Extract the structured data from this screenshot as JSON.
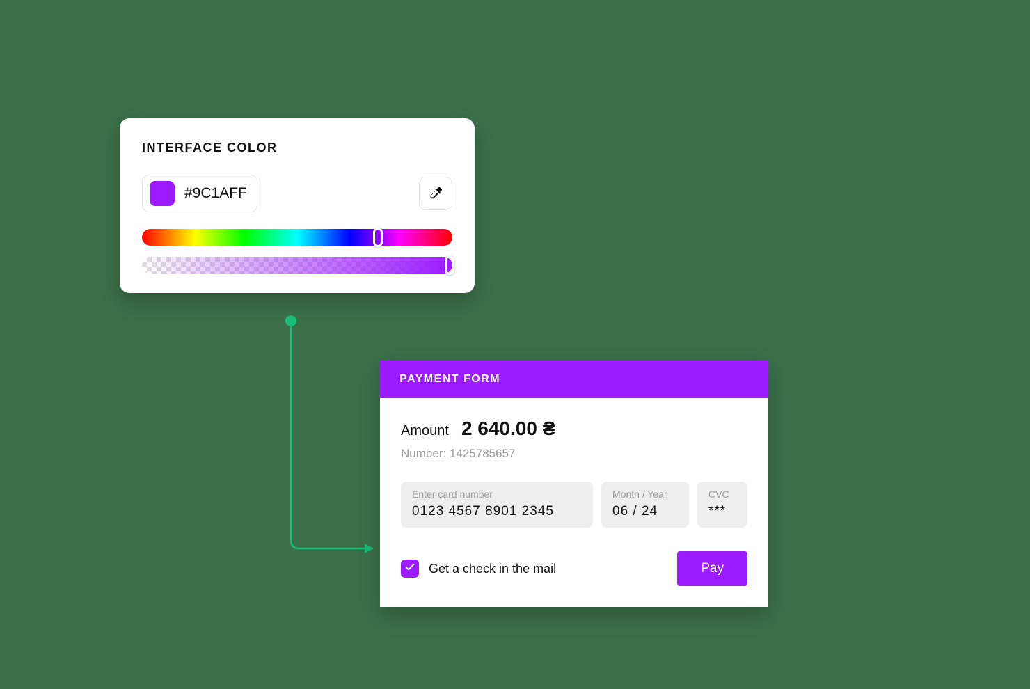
{
  "accent_color": "#9C1AFF",
  "connector_color": "#1abc7a",
  "color_picker": {
    "title": "INTERFACE COLOR",
    "hex_value": "#9C1AFF",
    "hue_thumb_percent": 76,
    "alpha_thumb_percent": 99,
    "icons": {
      "eyedropper": "eyedropper"
    }
  },
  "payment": {
    "title": "PAYMENT FORM",
    "amount_label": "Amount",
    "amount_value": "2 640.00 ₴",
    "number_label": "Number:",
    "number_value": "1425785657",
    "card": {
      "label": "Enter card number",
      "value": "0123  4567  8901  2345"
    },
    "expiry": {
      "label": "Month / Year",
      "value": "06  /  24"
    },
    "cvc": {
      "label": "CVC",
      "value": "***"
    },
    "check_label": "Get a check in the mail",
    "check_checked": true,
    "pay_label": "Pay"
  }
}
